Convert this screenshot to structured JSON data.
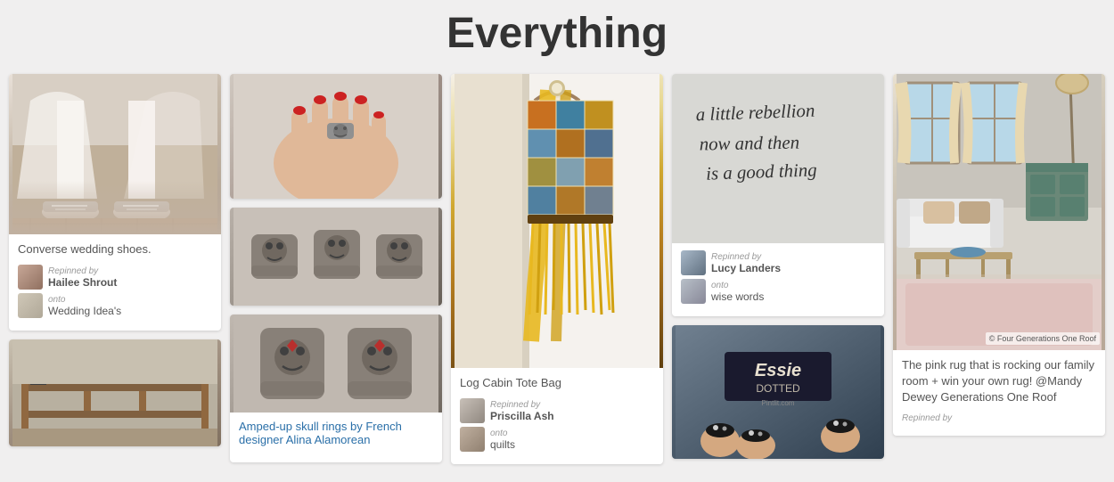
{
  "page": {
    "title": "Everything"
  },
  "columns": [
    {
      "id": "col1",
      "cards": [
        {
          "id": "wedding-shoes",
          "image_class": "img-wedding",
          "title": "Converse wedding shoes.",
          "repinned_by_label": "Repinned by",
          "repinned_by": "Hailee Shrout",
          "onto_label": "onto",
          "onto": "Wedding Idea's",
          "avatar_class": "av-hailee",
          "avatar_board_class": "av-board"
        },
        {
          "id": "furniture",
          "image_class": "img-furniture",
          "title": "",
          "repinned_by": "",
          "onto": ""
        }
      ]
    },
    {
      "id": "col2",
      "cards": [
        {
          "id": "skull-rings-top",
          "image_class": "img-rings-top",
          "title": "",
          "repinned_by": "",
          "onto": ""
        },
        {
          "id": "skull-rings-mid",
          "image_class": "img-rings-mid",
          "title": "",
          "repinned_by": "",
          "onto": ""
        },
        {
          "id": "skull-rings-bot",
          "image_class": "img-rings-bot",
          "title": "Amped-up skull rings by French designer Alina Alamorean",
          "repinned_by": "",
          "onto": "",
          "link": "Amped-up skull rings by French designer Alina Alamorean"
        }
      ]
    },
    {
      "id": "col3",
      "cards": [
        {
          "id": "tote-bag",
          "image_class": "img-tote",
          "title": "Log Cabin Tote Bag",
          "repinned_by_label": "Repinned by",
          "repinned_by": "Priscilla Ash",
          "onto_label": "onto",
          "onto": "quilts",
          "avatar_class": "av-priscilla",
          "avatar_board_class": "av-quilts"
        }
      ]
    },
    {
      "id": "col4",
      "cards": [
        {
          "id": "quote",
          "image_class": "img-quote",
          "quote": "a little rebellion now and then is a good thing",
          "repinned_by_label": "Repinned by",
          "repinned_by": "Lucy Landers",
          "onto_label": "onto",
          "onto": "wise words",
          "avatar_class": "av-lucy",
          "avatar_board_class": "av-wise"
        },
        {
          "id": "nails",
          "image_class": "img-nails",
          "title": "Essie Dotted",
          "repinned_by": "",
          "onto": ""
        }
      ]
    },
    {
      "id": "col5",
      "cards": [
        {
          "id": "room",
          "image_class": "img-room",
          "credit": "© Four Generations One Roof",
          "title": "The pink rug that is rocking our family room + win your own rug! @Mandy Dewey Generations One Roof",
          "repinned_by_label": "Repinned by",
          "repinned_by": "",
          "onto": ""
        }
      ]
    }
  ]
}
